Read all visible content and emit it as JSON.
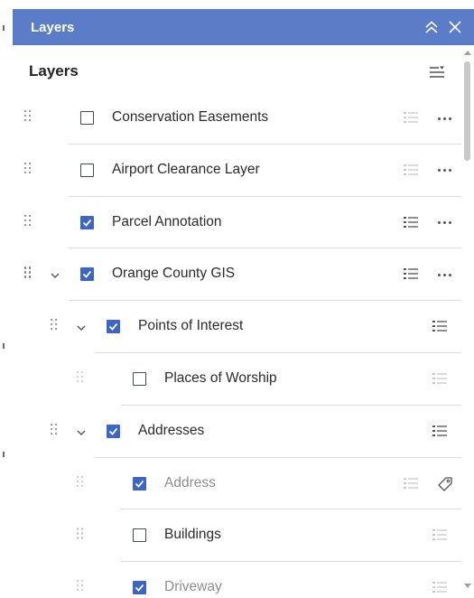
{
  "window": {
    "title": "Layers",
    "collapse_icon": "double-chevron-up-icon",
    "close_icon": "close-icon"
  },
  "panel": {
    "heading": "Layers",
    "options_icon": "list-options-icon"
  },
  "colors": {
    "titlebar": "#5b7dc8",
    "checkbox_checked": "#3d65c4"
  },
  "layers": [
    {
      "label": "Conservation Easements",
      "checked": false,
      "level": 0,
      "expandable": false,
      "legend": "legend-icon-faded",
      "action": "more-options-icon",
      "dimmed": false
    },
    {
      "label": "Airport Clearance Layer",
      "checked": false,
      "level": 0,
      "expandable": false,
      "legend": "legend-icon-faded",
      "action": "more-options-icon",
      "dimmed": false
    },
    {
      "label": "Parcel Annotation",
      "checked": true,
      "level": 0,
      "expandable": false,
      "legend": "legend-icon",
      "action": "more-options-icon",
      "dimmed": false
    },
    {
      "label": "Orange County GIS",
      "checked": true,
      "level": 0,
      "expandable": true,
      "legend": "legend-icon",
      "action": "more-options-icon",
      "dimmed": false
    },
    {
      "label": "Points of Interest",
      "checked": true,
      "level": 1,
      "expandable": true,
      "legend": "legend-icon",
      "action": "",
      "dimmed": false
    },
    {
      "label": "Places of Worship",
      "checked": false,
      "level": 2,
      "expandable": false,
      "legend": "legend-icon-faded",
      "action": "",
      "dimmed": false
    },
    {
      "label": "Addresses",
      "checked": true,
      "level": 1,
      "expandable": true,
      "legend": "legend-icon",
      "action": "",
      "dimmed": false
    },
    {
      "label": "Address",
      "checked": true,
      "level": 2,
      "expandable": false,
      "legend": "legend-icon-faded",
      "action": "tag-icon",
      "dimmed": true
    },
    {
      "label": "Buildings",
      "checked": false,
      "level": 2,
      "expandable": false,
      "legend": "legend-icon-faded",
      "action": "",
      "dimmed": false
    },
    {
      "label": "Driveway",
      "checked": true,
      "level": 2,
      "expandable": false,
      "legend": "legend-icon-faded",
      "action": "",
      "dimmed": true
    }
  ]
}
